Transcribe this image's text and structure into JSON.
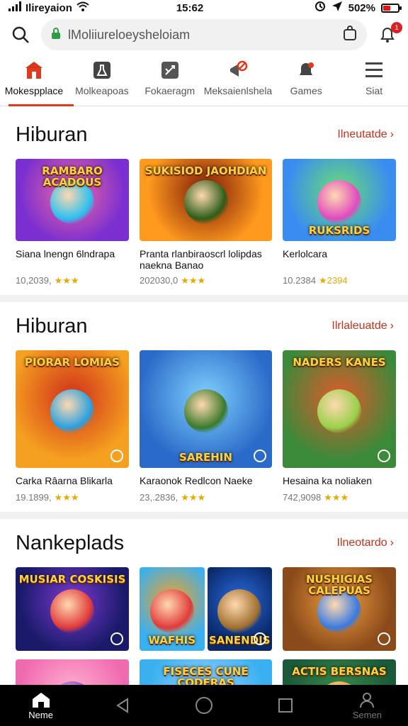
{
  "status": {
    "carrier": "Ilireyaion",
    "time": "15:62",
    "battery": "502%",
    "battery_level": 0.5
  },
  "search": {
    "value": "lMoliiureloeysheloiam",
    "notifications": "1"
  },
  "categories": [
    {
      "label": "Mokespplace",
      "icon": "store-icon",
      "active": true
    },
    {
      "label": "Molkeapoas",
      "icon": "flask-icon"
    },
    {
      "label": "Fokaeragm",
      "icon": "tools-icon"
    },
    {
      "label": "Meksaienlshela",
      "icon": "megaphone-icon"
    },
    {
      "label": "Games",
      "icon": "game-bell-icon"
    },
    {
      "label": "Siat",
      "icon": "menu-icon"
    }
  ],
  "sections": [
    {
      "title": "Hiburan",
      "more": "Ilneutatde",
      "cards": [
        {
          "title": "Siana lnengn 6lndrapa",
          "meta": "10,2039,",
          "stars": "★★★",
          "logo": "RAMBARO ACADOUS",
          "c1": "#7b2fd0",
          "c2": "#f06aa0",
          "c3": "#2ac0f0"
        },
        {
          "title": "Pranta rlanbiraoscrl lolipdas naekna Banao",
          "meta": "202030,0",
          "stars": "★★★",
          "logo": "SUKISIOD JAOHDIAN",
          "c1": "#ff9a1e",
          "c2": "#7a1808",
          "c3": "#2d5d1a"
        },
        {
          "title": "Kerlolcara",
          "meta": "10.2384",
          "stars": "★2394",
          "logo": "RUKSRIDS",
          "c1": "#3a8df0",
          "c2": "#6adf70",
          "c3": "#e04ac0"
        }
      ]
    },
    {
      "title": "Hiburan",
      "more": "Ilrlaleuatde",
      "cards": [
        {
          "title": "Carka Râarna Blikarla",
          "meta": "19.1899,",
          "stars": "★★★",
          "logo": "PIORAR LOMIAS",
          "c1": "#f5a020",
          "c2": "#d0301a",
          "c3": "#2aa0e0"
        },
        {
          "title": "Karaonok Redlcon Naeke",
          "meta": "23,.2836,",
          "stars": "★★★",
          "logo": "SAREHIN",
          "c1": "#2a6ac8",
          "c2": "#7fd0ff",
          "c3": "#3a7a2a"
        },
        {
          "title": "Hesaina ka noliaken",
          "meta": "742,9098",
          "stars": "★★★",
          "logo": "NADERS KANES",
          "c1": "#3a8a3a",
          "c2": "#e05a2a",
          "c3": "#9ad04a"
        }
      ]
    },
    {
      "title": "Nankeplads",
      "more": "Ilneotardo",
      "cards": [
        {
          "logo": "MUSIAR COSKISIS",
          "c1": "#1a1a6a",
          "c2": "#7a3ad0",
          "c3": "#e03a3a"
        },
        {
          "logo": "WAFHIS",
          "c1": "#3ab0f0",
          "c2": "#f5a020",
          "c3": "#e03a3a"
        },
        {
          "logo": "SANENDIS",
          "c1": "#0a2a6a",
          "c2": "#2a6ae0",
          "c3": "#a07030"
        },
        {
          "logo": "NUSHIGIAS CALEPUAS",
          "c1": "#8a4a1a",
          "c2": "#f0a040",
          "c3": "#3a7ae0"
        }
      ],
      "more_cards": [
        {
          "logo": "",
          "c1": "#f06ab0",
          "c2": "#ffb0d0",
          "c3": "#7a3ad0"
        },
        {
          "logo": "FISECES CUNE CODERAS",
          "c1": "#3ab0f0",
          "c2": "#9ad0ff",
          "c3": "#2a7a3a"
        },
        {
          "logo": "ACTIS BERSNAS",
          "c1": "#1a5a3a",
          "c2": "#3a8a4a",
          "c3": "#e0a030"
        }
      ]
    }
  ],
  "bottom_nav": [
    {
      "label": "Neme",
      "icon": "home-icon",
      "active": true
    },
    {
      "label": "",
      "icon": "back-icon"
    },
    {
      "label": "",
      "icon": "home-circle-icon"
    },
    {
      "label": "",
      "icon": "recents-icon"
    },
    {
      "label": "Semen",
      "icon": "profile-icon"
    }
  ],
  "colors": {
    "accent": "#e03a1e",
    "star": "#e9a900"
  }
}
